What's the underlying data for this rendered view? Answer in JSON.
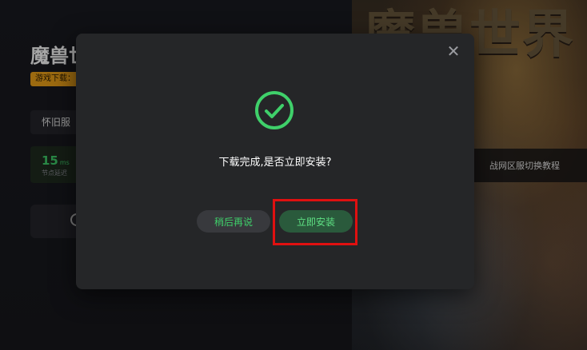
{
  "background": {
    "art_title": "魔兽世界",
    "game_title": "魔兽世界",
    "tag": "游戏下载：",
    "classic_button": "怀旧服",
    "latency": {
      "value": "15",
      "unit": "ms",
      "label": "节点延迟"
    },
    "guide_link": "战网区服切换教程"
  },
  "dialog": {
    "message": "下载完成,是否立即安装?",
    "later_label": "稍后再说",
    "install_label": "立即安装",
    "close_symbol": "✕"
  },
  "colors": {
    "accent": "#3fd06a",
    "install_bg": "#2a5a3c",
    "highlight": "#e01010"
  }
}
